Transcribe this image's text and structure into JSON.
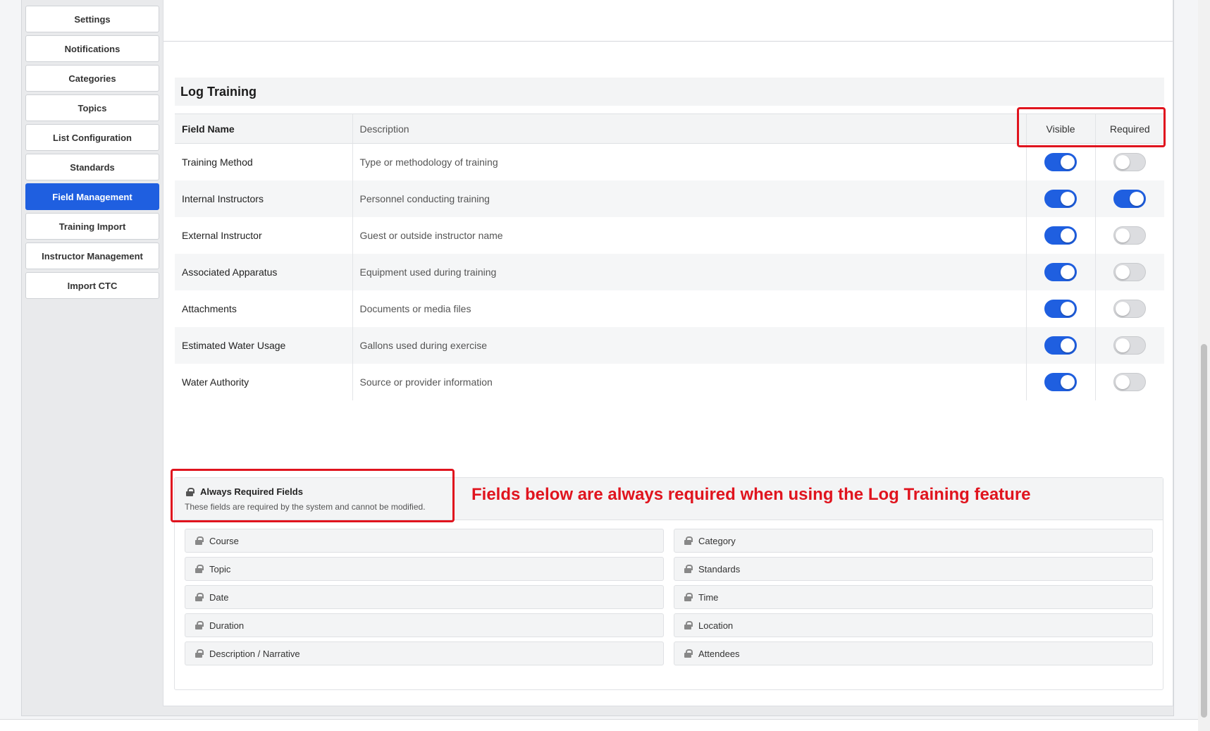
{
  "sidebar": {
    "items": [
      {
        "label": "Settings"
      },
      {
        "label": "Notifications"
      },
      {
        "label": "Categories"
      },
      {
        "label": "Topics"
      },
      {
        "label": "List Configuration"
      },
      {
        "label": "Standards"
      },
      {
        "label": "Field Management",
        "active": true
      },
      {
        "label": "Training Import"
      },
      {
        "label": "Instructor Management"
      },
      {
        "label": "Import CTC"
      }
    ]
  },
  "section": {
    "title": "Log Training",
    "columns": {
      "field_name": "Field Name",
      "description": "Description",
      "visible": "Visible",
      "required": "Required"
    },
    "rows": [
      {
        "name": "Training Method",
        "description": "Type or methodology of training",
        "visible": true,
        "required": false
      },
      {
        "name": "Internal Instructors",
        "description": "Personnel conducting training",
        "visible": true,
        "required": true
      },
      {
        "name": "External Instructor",
        "description": "Guest or outside instructor name",
        "visible": true,
        "required": false
      },
      {
        "name": "Associated Apparatus",
        "description": "Equipment used during training",
        "visible": true,
        "required": false
      },
      {
        "name": "Attachments",
        "description": "Documents or media files",
        "visible": true,
        "required": false
      },
      {
        "name": "Estimated Water Usage",
        "description": "Gallons used during exercise",
        "visible": true,
        "required": false
      },
      {
        "name": "Water Authority",
        "description": "Source or provider information",
        "visible": true,
        "required": false
      }
    ]
  },
  "always_required": {
    "title": "Always Required Fields",
    "subtitle": "These fields are required by the system and cannot be modified.",
    "annotation": "Fields below are always required when using the Log Training feature",
    "left": [
      "Course",
      "Topic",
      "Date",
      "Duration",
      "Description / Narrative"
    ],
    "right": [
      "Category",
      "Standards",
      "Time",
      "Location",
      "Attendees"
    ]
  },
  "colors": {
    "accent": "#1f5fe0",
    "highlight": "#e0141e"
  }
}
